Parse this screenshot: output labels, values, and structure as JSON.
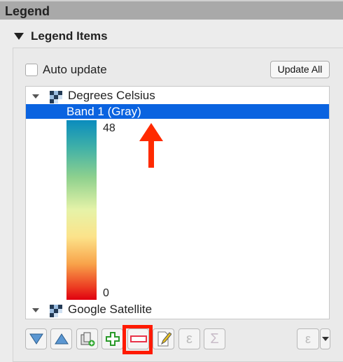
{
  "panel": {
    "title": "Legend"
  },
  "section": {
    "title": "Legend Items"
  },
  "auto_update": {
    "label": "Auto update",
    "checked": false
  },
  "update_all": {
    "label": "Update All"
  },
  "tree": {
    "layers": [
      {
        "name": "Degrees Celsius",
        "expanded": true,
        "icon": "raster-icon"
      },
      {
        "name": "Google Satellite",
        "expanded": true,
        "icon": "raster-icon"
      }
    ],
    "selected_item": "Band 1 (Gray)",
    "ramp": {
      "max": "48",
      "min": "0",
      "colors": [
        "#0a8cbe",
        "#8fd18e",
        "#fce38a",
        "#f8a34a",
        "#e00010"
      ]
    }
  },
  "toolbar": {
    "buttons": [
      "move-down",
      "move-up",
      "add-group",
      "add-item",
      "remove-item",
      "edit-item",
      "expression",
      "count",
      "filter-by-expression"
    ],
    "highlighted": "remove-item",
    "epsilon": "ε",
    "sigma": "Σ"
  },
  "annotation_color": "#ff1a00"
}
